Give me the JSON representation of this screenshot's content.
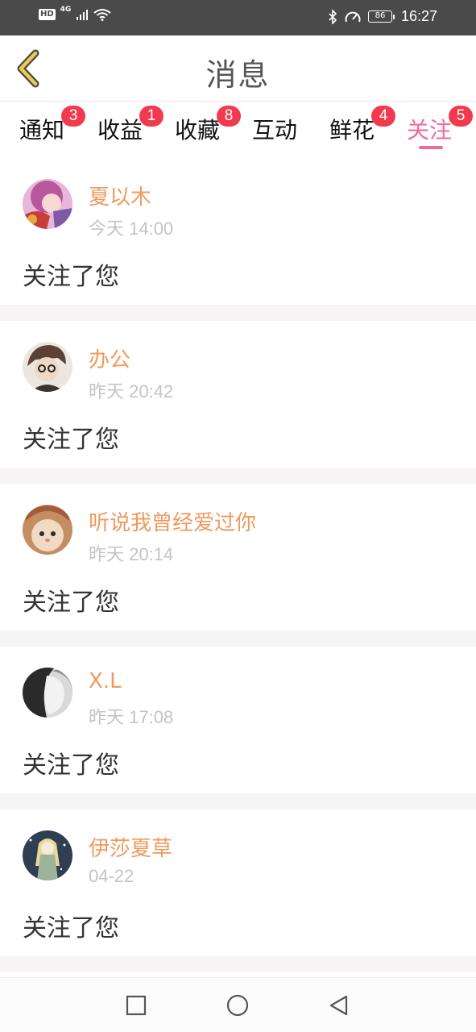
{
  "status_bar": {
    "hd": "HD",
    "network": "4G",
    "battery": "86",
    "time": "16:27"
  },
  "header": {
    "title": "消息",
    "back_icon": "chevron-left-icon"
  },
  "tabs": [
    {
      "label": "通知",
      "badge": "3",
      "active": false
    },
    {
      "label": "收益",
      "badge": "1",
      "active": false
    },
    {
      "label": "收藏",
      "badge": "8",
      "active": false
    },
    {
      "label": "互动",
      "badge": "",
      "active": false
    },
    {
      "label": "鲜花",
      "badge": "4",
      "active": false
    },
    {
      "label": "关注",
      "badge": "5",
      "active": true
    }
  ],
  "colors": {
    "accent": "#f06aa0",
    "badge": "#f23a4e",
    "username": "#ef9a5e",
    "timestamp": "#c4c4c4",
    "back_icon": "#f2c94c"
  },
  "notifications": [
    {
      "user": "夏以木",
      "time": "今天 14:00",
      "action": "关注了您"
    },
    {
      "user": "办公",
      "time": "昨天 20:42",
      "action": "关注了您"
    },
    {
      "user": "听说我曾经爱过你",
      "time": "昨天 20:14",
      "action": "关注了您"
    },
    {
      "user": "X.L",
      "time": "昨天 17:08",
      "action": "关注了您"
    },
    {
      "user": "伊莎夏草",
      "time": "04-22",
      "action": "关注了您"
    }
  ],
  "nav_bar": {
    "icons": [
      "square-recents-icon",
      "circle-home-icon",
      "triangle-back-icon"
    ]
  }
}
